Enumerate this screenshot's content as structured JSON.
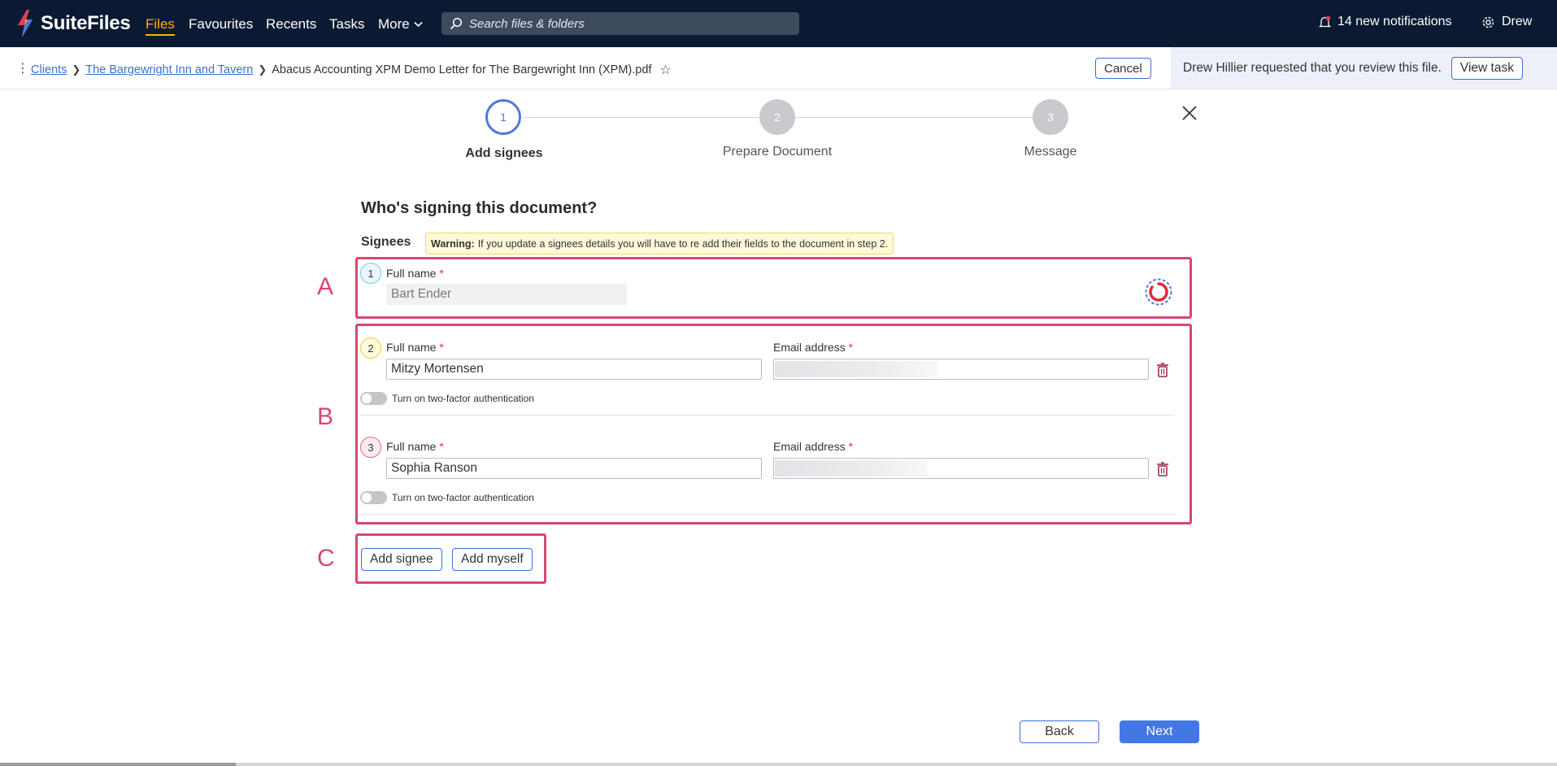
{
  "app": {
    "name": "SuiteFiles"
  },
  "nav": {
    "items": [
      {
        "label": "Files",
        "active": true
      },
      {
        "label": "Favourites"
      },
      {
        "label": "Recents"
      },
      {
        "label": "Tasks"
      },
      {
        "label": "More"
      }
    ],
    "search_placeholder": "Search files & folders",
    "notifications": "14 new notifications",
    "user": "Drew"
  },
  "breadcrumb": {
    "items": [
      "Clients",
      "The Bargewright Inn and Tavern"
    ],
    "current": "Abacus Accounting XPM Demo Letter for The Bargewright Inn (XPM).pdf",
    "cancel_label": "Cancel"
  },
  "review": {
    "message": "Drew Hillier requested that you review this file.",
    "button_label": "View task"
  },
  "stepper": {
    "steps": [
      {
        "number": "1",
        "label": "Add signees",
        "active": true
      },
      {
        "number": "2",
        "label": "Prepare Document"
      },
      {
        "number": "3",
        "label": "Message"
      }
    ]
  },
  "form": {
    "title": "Who's signing this document?",
    "signees_label": "Signees",
    "warning_bold": "Warning:",
    "warning_text": "If you update a signees details you will have to re add their fields to the document in step 2.",
    "full_name_label": "Full name",
    "email_label": "Email address",
    "required_mark": "*",
    "two_factor_label": "Turn on two-factor authentication",
    "signees": [
      {
        "number": "1",
        "full_name": "Bart Ender"
      },
      {
        "number": "2",
        "full_name": "Mitzy Mortensen",
        "email": ""
      },
      {
        "number": "3",
        "full_name": "Sophia Ranson",
        "email": ""
      }
    ],
    "add_signee_label": "Add signee",
    "add_myself_label": "Add myself"
  },
  "annotations": {
    "a": "A",
    "b": "B",
    "c": "C"
  },
  "footer": {
    "back_label": "Back",
    "next_label": "Next"
  },
  "colors": {
    "nav_bg": "#0b1a33",
    "accent": "#4277e6",
    "active_nav": "#f5b400",
    "annotation": "#d9476e"
  }
}
